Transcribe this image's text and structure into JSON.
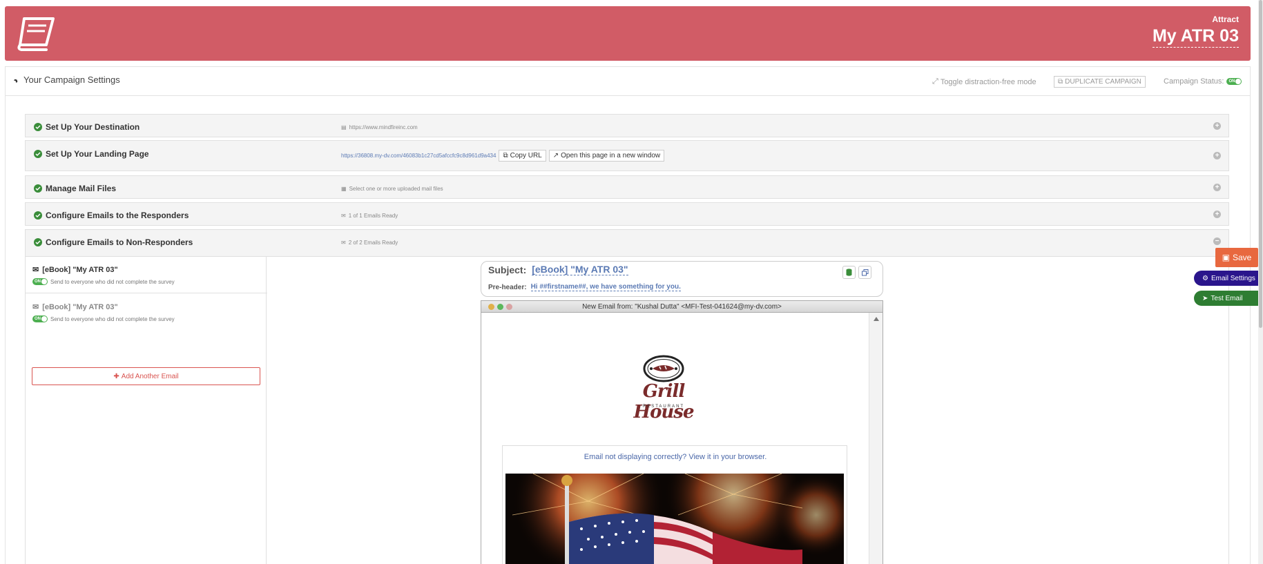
{
  "header": {
    "subtitle": "Attract",
    "title": "My ATR 03",
    "banner_color": "#d15c66"
  },
  "settings": {
    "title": "Your Campaign Settings",
    "toggle_label": "Toggle distraction-free mode",
    "duplicate_label": "DUPLICATE CAMPAIGN",
    "status_label": "Campaign Status:",
    "switch_on_text": "ON"
  },
  "sections": [
    {
      "title": "Set Up Your Destination",
      "info": "https://www.mindfireinc.com"
    },
    {
      "title": "Set Up Your Landing Page",
      "info": "https://36808.my-dv.com/46083b1c27cd5afccfc9c8d961d9a434",
      "copy_url": "Copy URL",
      "open_window": "Open this page in a new window"
    },
    {
      "title": "Manage Mail Files",
      "info": "Select one or more uploaded mail files"
    },
    {
      "title": "Configure Emails to the Responders",
      "info": "1 of 1 Emails Ready"
    },
    {
      "title": "Configure Emails to Non-Responders",
      "info": "2 of 2 Emails Ready"
    }
  ],
  "emails": [
    {
      "name": "[eBook] \"My ATR 03\"",
      "desc": "Send to everyone who did not complete the survey"
    },
    {
      "name": "[eBook] \"My ATR 03\"",
      "desc": "Send to everyone who did not complete the survey"
    }
  ],
  "add_email_label": "Add Another Email",
  "subject": {
    "label": "Subject:",
    "value": "[eBook] \"My ATR 03\"",
    "preheader_label": "Pre-header:",
    "preheader_value": "Hi ##firstname##, we have something for you."
  },
  "preview": {
    "window_title": "New Email from: \"Kushal Dutta\" <MFI-Test-041624@my-dv.com>",
    "logo_text": "Grill House",
    "logo_sub": "RESTAURANT",
    "view_browser": "Email not displaying correctly? View it in your browser."
  },
  "actions": {
    "save": "Save",
    "email_settings": "Email Settings",
    "test_email": "Test Email"
  }
}
